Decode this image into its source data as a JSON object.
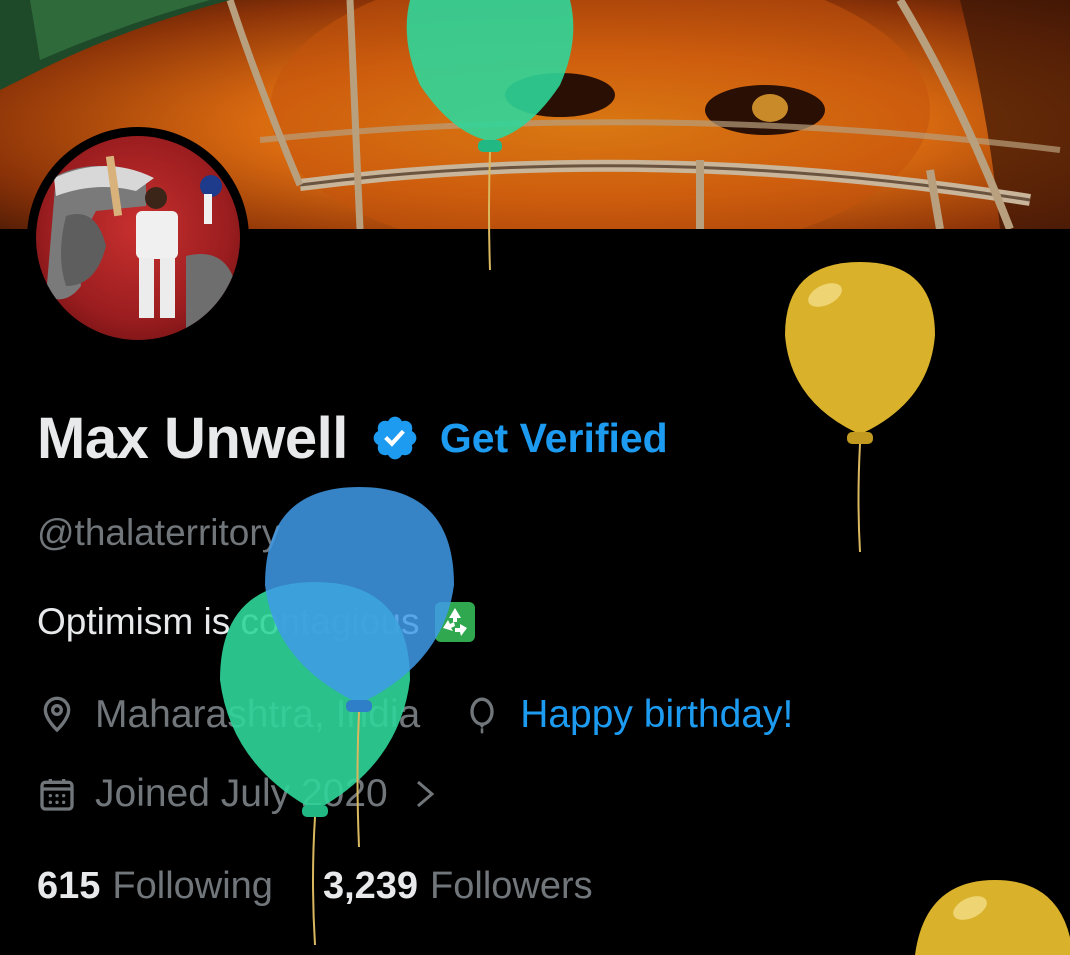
{
  "profile": {
    "display_name": "Max Unwell",
    "get_verified_label": "Get Verified",
    "handle": "@thalaterritory",
    "bio": "Optimism is contagious",
    "location": "Maharashtra, India",
    "birthday": "Happy birthday!",
    "joined": "Joined July 2020"
  },
  "stats": {
    "following_count": "615",
    "following_label": "Following",
    "followers_count": "3,239",
    "followers_label": "Followers"
  },
  "icons": {
    "verified": "verified-badge-icon",
    "location": "location-pin-icon",
    "birthday": "balloon-icon",
    "calendar": "calendar-icon",
    "chevron": "chevron-right-icon",
    "bio_emoji": "recycle-icon"
  },
  "colors": {
    "background": "#000000",
    "accent": "#1d9bf0",
    "secondary_text": "#71767b",
    "primary_text": "#e7e9ea",
    "balloon_green": "#2fd69a",
    "balloon_blue": "#3f9ae8",
    "balloon_yellow": "#d9b12a"
  }
}
